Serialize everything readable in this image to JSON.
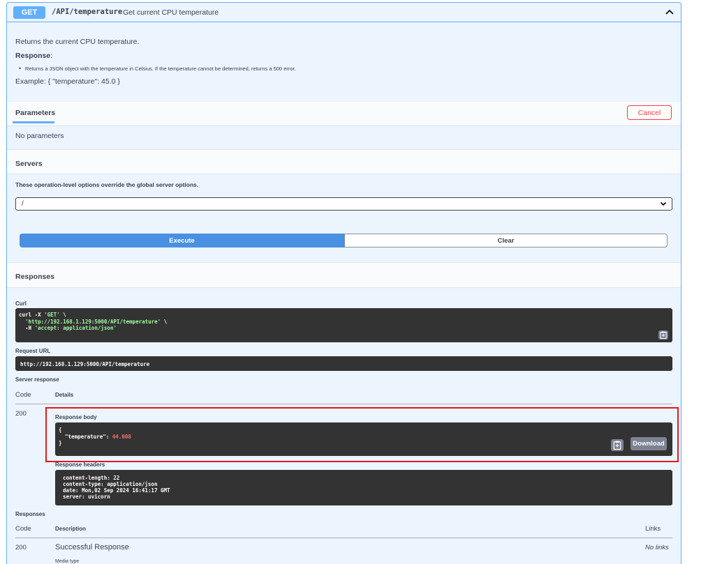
{
  "operation": {
    "method": "GET",
    "path": "/API/temperature",
    "summary": "Get current CPU temperature",
    "description": "Returns the current CPU temperature.",
    "response_heading": "Response",
    "response_colon": ":",
    "response_bullet": "Returns a JSON object with the temperature in Celsius. If the temperature cannot be determined, returns a 500 error.",
    "example": "Example: { \"temperature\": 45.0 }"
  },
  "parameters": {
    "tab_label": "Parameters",
    "cancel_label": "Cancel",
    "empty_text": "No parameters"
  },
  "servers": {
    "heading": "Servers",
    "note": "These operation-level options override the global server options.",
    "selected": "/"
  },
  "actions": {
    "execute_label": "Execute",
    "clear_label": "Clear"
  },
  "responses_section": {
    "heading": "Responses",
    "curl_label": "Curl",
    "curl_line1_cmd": "curl -X ",
    "curl_line1_str": "'GET'",
    "curl_line1_tail": " \\",
    "curl_line2_str": "'http://192.168.1.129:5000/API/temperature'",
    "curl_line2_tail": " \\",
    "curl_line3_cmd": "  -H ",
    "curl_line3_str": "'accept: application/json'",
    "request_url_label": "Request URL",
    "request_url": "http://192.168.1.129:5000/API/temperature",
    "server_response_label": "Server response",
    "code_header": "Code",
    "details_header": "Details",
    "status_code": "200",
    "response_body_label": "Response body",
    "body_open": "{",
    "body_key": "  \"temperature\": ",
    "body_value": "44.008",
    "body_close": "}",
    "download_label": "Download",
    "response_headers_label": "Response headers",
    "headers": [
      "content-length: 22",
      "content-type: application/json",
      "date: Mon,02 Sep 2024 16:41:17 GMT",
      "server: uvicorn"
    ]
  },
  "responses_table": {
    "heading": "Responses",
    "code_header": "Code",
    "description_header": "Description",
    "links_header": "Links",
    "row_code": "200",
    "row_description": "Successful Response",
    "row_links": "No links",
    "media_type_label": "Media type"
  },
  "colors": {
    "get_blue": "#61affe",
    "execute_blue": "#4990e2",
    "cancel_red": "#f93e3e",
    "highlight_red": "#e1191f",
    "code_bg": "#333333"
  }
}
